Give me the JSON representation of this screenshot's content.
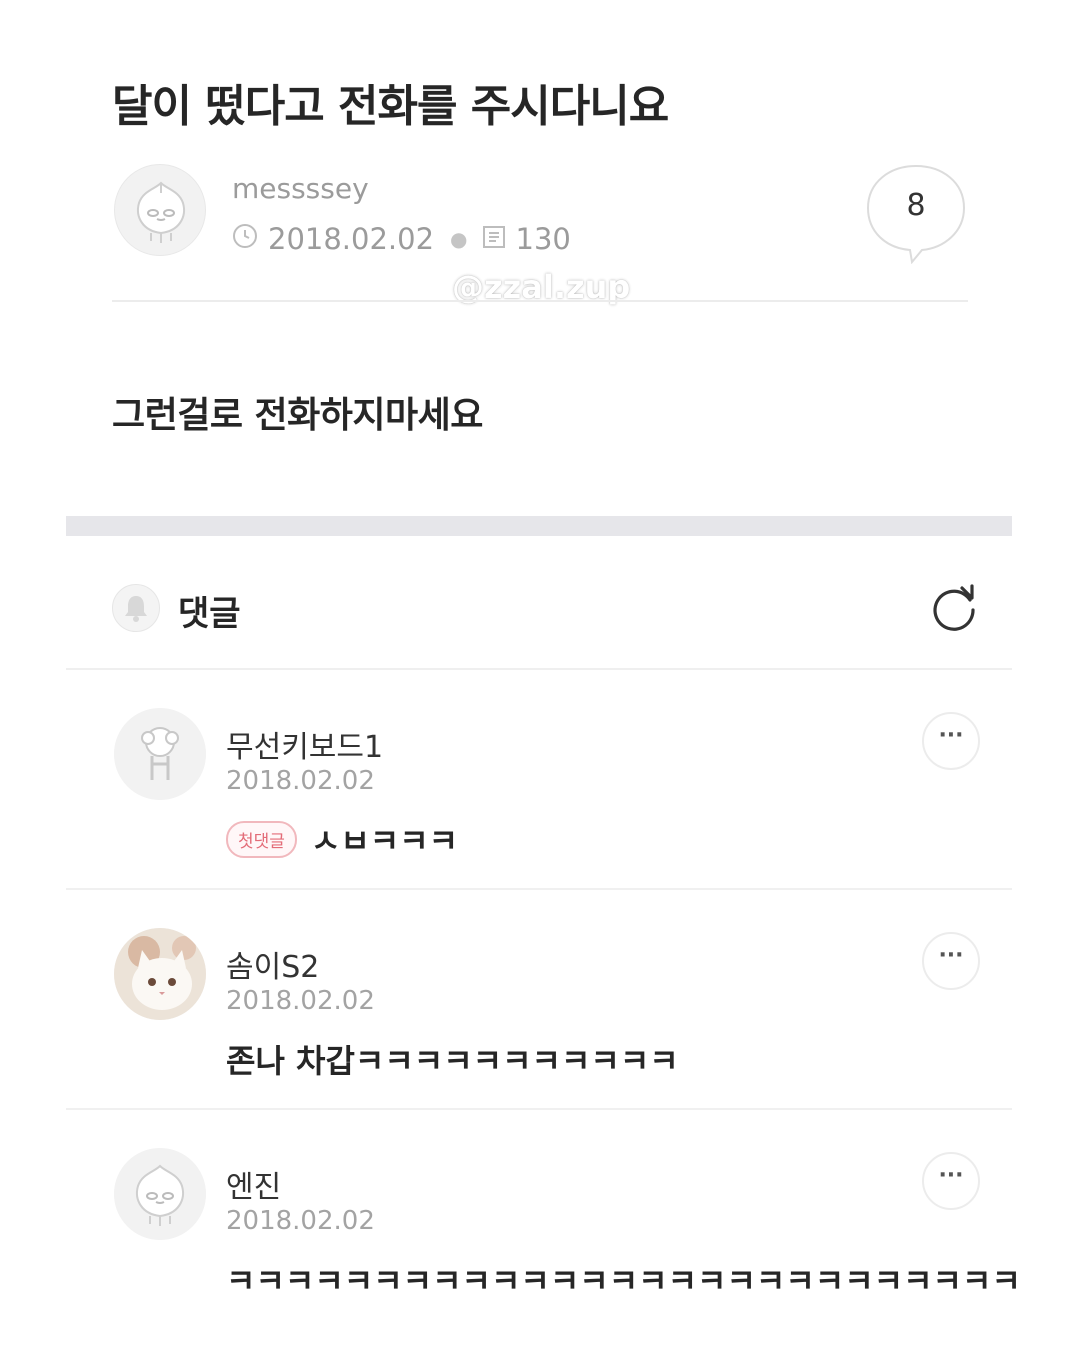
{
  "post": {
    "title": "달이 떴다고 전화를 주시다니요",
    "author": "messssey",
    "date": "2018.02.02",
    "views": "130",
    "comment_count": "8",
    "body": "그런걸로 전화하지마세요"
  },
  "watermark": "@zzal.zup",
  "comments_section": {
    "label": "댓글"
  },
  "comments": [
    {
      "name": "무선키보드1",
      "date": "2018.02.02",
      "badge": "첫댓글",
      "text": "ㅅㅂㅋㅋㅋ",
      "avatar": "cartoon-character-icon"
    },
    {
      "name": "솜이S2",
      "date": "2018.02.02",
      "text": "존나 차갑ㅋㅋㅋㅋㅋㅋㅋㅋㅋㅋㅋ",
      "avatar": "cat-photo"
    },
    {
      "name": "엔진",
      "date": "2018.02.02",
      "text": "ㅋㅋㅋㅋㅋㅋㅋㅋㅋㅋㅋㅋㅋㅋㅋㅋㅋㅋㅋㅋㅋㅋㅋㅋㅋㅋㅋ",
      "avatar": "peach-character-icon"
    }
  ],
  "more_label": "···",
  "colors": {
    "badge_text": "#e36c78",
    "badge_border": "#f1b8bd",
    "muted_text": "#9b9b9b",
    "section_bar": "#e6e6ea"
  }
}
